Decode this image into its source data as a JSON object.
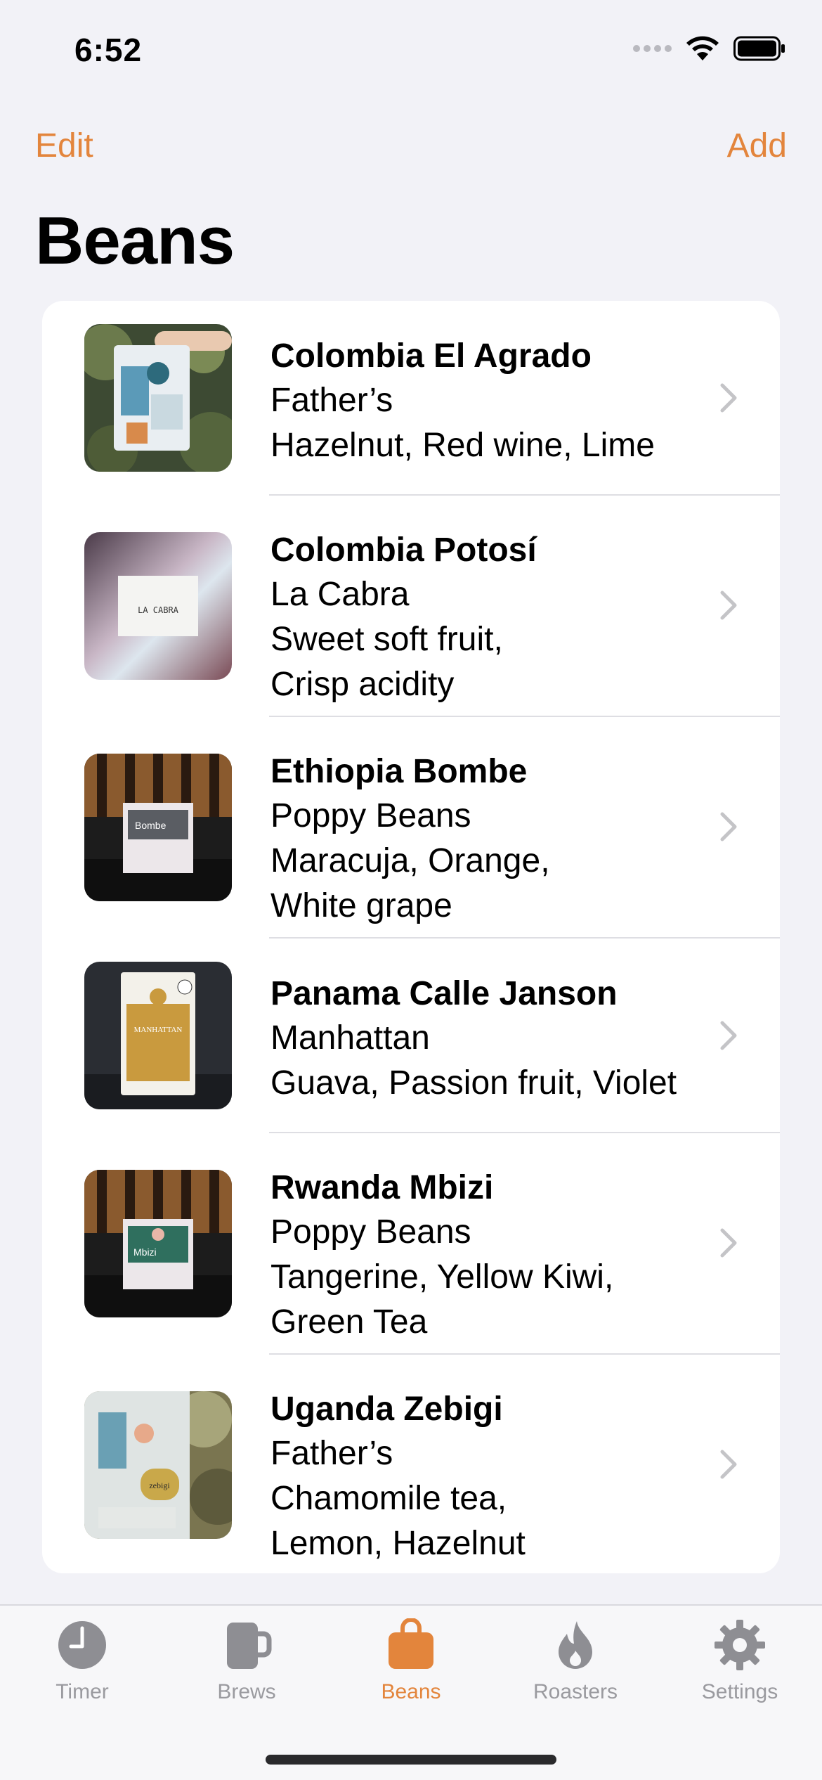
{
  "status_bar": {
    "time": "6:52"
  },
  "nav": {
    "edit_label": "Edit",
    "add_label": "Add",
    "title": "Beans"
  },
  "beans": [
    {
      "name": "Colombia El Agrado",
      "roaster": "Father’s",
      "notes": [
        "Hazelnut, Red wine, Lime"
      ]
    },
    {
      "name": "Colombia Potosí",
      "roaster": "La Cabra",
      "notes": [
        "Sweet soft fruit,",
        "Crisp acidity"
      ]
    },
    {
      "name": "Ethiopia Bombe",
      "roaster": "Poppy Beans",
      "notes": [
        "Maracuja, Orange,",
        "White grape"
      ]
    },
    {
      "name": "Panama Calle Janson",
      "roaster": "Manhattan",
      "notes": [
        "Guava, Passion fruit, Violet"
      ]
    },
    {
      "name": "Rwanda Mbizi",
      "roaster": "Poppy Beans",
      "notes": [
        "Tangerine, Yellow Kiwi,",
        "Green Tea"
      ]
    },
    {
      "name": "Uganda Zebigi",
      "roaster": "Father’s",
      "notes": [
        "Chamomile tea,",
        "Lemon, Hazelnut"
      ]
    }
  ],
  "package_labels": {
    "la_cabra": "LA CABRA",
    "bombe": "Bombe",
    "manhattan": "MANHATTAN",
    "mbizi": "Mbizi",
    "zebigi": "zebigi"
  },
  "tabs": [
    {
      "label": "Timer",
      "icon": "clock-icon",
      "active": false
    },
    {
      "label": "Brews",
      "icon": "mug-icon",
      "active": false
    },
    {
      "label": "Beans",
      "icon": "bag-icon",
      "active": true
    },
    {
      "label": "Roasters",
      "icon": "flame-icon",
      "active": false
    },
    {
      "label": "Settings",
      "icon": "gear-icon",
      "active": false
    }
  ],
  "colors": {
    "accent": "#e3853c",
    "inactive": "#9a9a9f",
    "background": "#f2f2f7"
  }
}
